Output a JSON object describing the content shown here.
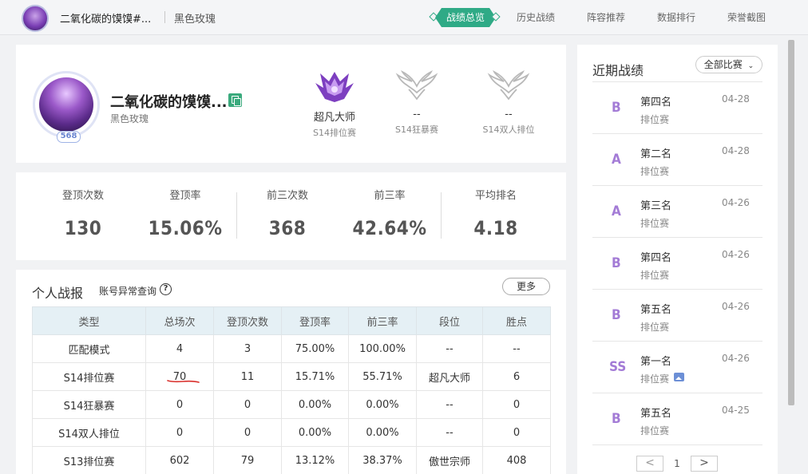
{
  "header": {
    "player_name": "二氧化碳的馍馍#...",
    "title": "黑色玫瑰",
    "tabs": [
      {
        "label": "战绩总览",
        "active": true
      },
      {
        "label": "历史战绩"
      },
      {
        "label": "阵容推荐"
      },
      {
        "label": "数据排行"
      },
      {
        "label": "荣誉截图"
      }
    ]
  },
  "profile": {
    "name": "二氧化碳的馍馍...",
    "title": "黑色玫瑰",
    "level": "568",
    "ranks": [
      {
        "name": "超凡大师",
        "mode": "S14排位赛",
        "icon": "master-rank-emblem-icon"
      },
      {
        "name": "--",
        "mode": "S14狂暴赛",
        "icon": "unranked-emblem-icon"
      },
      {
        "name": "--",
        "mode": "S14双人排位",
        "icon": "unranked-emblem-icon"
      }
    ]
  },
  "stats": [
    {
      "label": "登顶次数",
      "value": "130"
    },
    {
      "label": "登顶率",
      "value": "15.06%"
    },
    {
      "label": "前三次数",
      "value": "368"
    },
    {
      "label": "前三率",
      "value": "42.64%"
    },
    {
      "label": "平均排名",
      "value": "4.18"
    }
  ],
  "report": {
    "title": "个人战报",
    "link": "账号异常查询",
    "more": "更多",
    "columns": [
      "类型",
      "总场次",
      "登顶次数",
      "登顶率",
      "前三率",
      "段位",
      "胜点"
    ],
    "rows": [
      [
        "匹配模式",
        "4",
        "3",
        "75.00%",
        "100.00%",
        "--",
        "--"
      ],
      [
        "S14排位赛",
        "70",
        "11",
        "15.71%",
        "55.71%",
        "超凡大师",
        "6"
      ],
      [
        "S14狂暴赛",
        "0",
        "0",
        "0.00%",
        "0.00%",
        "--",
        "0"
      ],
      [
        "S14双人排位",
        "0",
        "0",
        "0.00%",
        "0.00%",
        "--",
        "0"
      ],
      [
        "S13排位赛",
        "602",
        "79",
        "13.12%",
        "38.37%",
        "傲世宗师",
        "408"
      ]
    ]
  },
  "recent": {
    "title": "近期战绩",
    "filter": "全部比赛",
    "matches": [
      {
        "grade": "B",
        "place": "第四名",
        "mode": "排位赛",
        "date": "04-28"
      },
      {
        "grade": "A",
        "place": "第二名",
        "mode": "排位赛",
        "date": "04-28"
      },
      {
        "grade": "A",
        "place": "第三名",
        "mode": "排位赛",
        "date": "04-26"
      },
      {
        "grade": "B",
        "place": "第四名",
        "mode": "排位赛",
        "date": "04-26"
      },
      {
        "grade": "B",
        "place": "第五名",
        "mode": "排位赛",
        "date": "04-26"
      },
      {
        "grade": "SS",
        "place": "第一名",
        "mode": "排位赛",
        "date": "04-26",
        "has_image": true
      },
      {
        "grade": "B",
        "place": "第五名",
        "mode": "排位赛",
        "date": "04-25"
      }
    ],
    "pager": {
      "prev": "<",
      "page": "1",
      "next": ">"
    }
  },
  "colors": {
    "accent": "#2faa86",
    "grade": "#a37bd6",
    "table_header": "#e5f0f5",
    "annotation": "#d9302c"
  }
}
